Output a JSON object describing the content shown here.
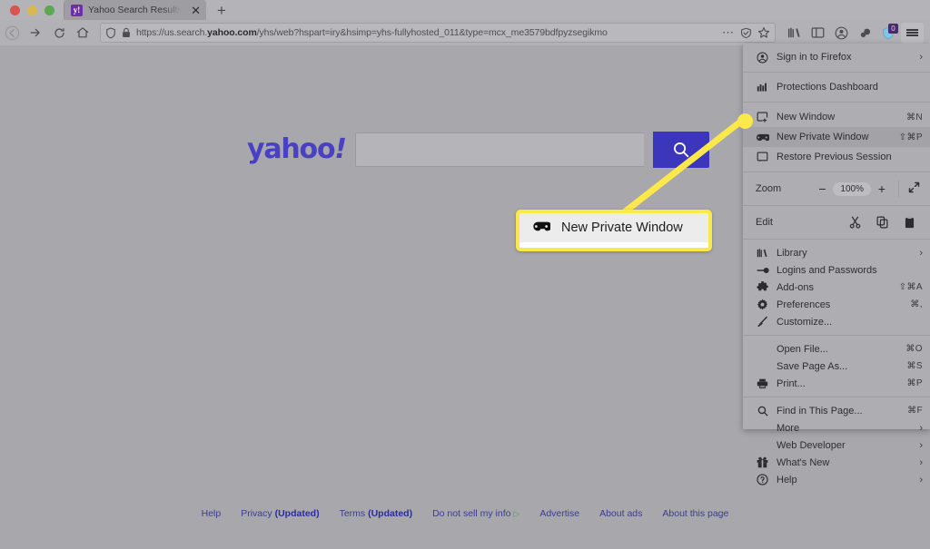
{
  "window": {
    "traffic_lights": [
      "close",
      "minimize",
      "maximize"
    ]
  },
  "tabbar": {
    "tab_title": "Yahoo Search Results - Web Se",
    "favicon_letter": "y!",
    "close_label": "✕",
    "newtab_label": "+"
  },
  "toolbar": {
    "back_label": "←",
    "forward_label": "→",
    "reload_label": "⟳",
    "home_label": "⌂",
    "url": "https://us.search.yahoo.com/yhs/web?hspart=iry&hsimp=yhs-fullyhosted_011&type=mcx_me3579bdfpyzsegikmo",
    "url_domain": "yahoo.com",
    "url_prefix": "https://us.search.",
    "url_suffix": "/yhs/web?hspart=iry&hsimp=yhs-fullyhosted_011&type=mcx_me3579bdfpyzsegikmo",
    "overflow_label": "⋯",
    "extension_badge": "0"
  },
  "content": {
    "brand": "yahoo",
    "brand_bang": "!",
    "search_value": "",
    "search_placeholder": ""
  },
  "footer": {
    "links": [
      {
        "label": "Help",
        "updated": ""
      },
      {
        "label": "Privacy",
        "updated": "(Updated)"
      },
      {
        "label": "Terms",
        "updated": "(Updated)"
      },
      {
        "label": "Do not sell my info",
        "updated": ""
      },
      {
        "label": "Advertise",
        "updated": ""
      },
      {
        "label": "About ads",
        "updated": ""
      },
      {
        "label": "About this page",
        "updated": ""
      }
    ]
  },
  "callout": {
    "label": "New Private Window",
    "highlight_color": "#fbe84a"
  },
  "menu": {
    "groups": [
      {
        "items": [
          {
            "label": "Sign in to Firefox",
            "key": "",
            "chevron": "›",
            "icon": "account-icon"
          },
          {
            "label": "Protections Dashboard",
            "key": "",
            "chevron": "",
            "icon": "shield-chart-icon"
          }
        ]
      },
      {
        "items": [
          {
            "label": "New Window",
            "key": "⌘N",
            "chevron": "",
            "icon": "new-window-icon"
          },
          {
            "label": "New Private Window",
            "key": "⇧⌘P",
            "chevron": "",
            "icon": "private-window-icon",
            "highlighted": true
          },
          {
            "label": "Restore Previous Session",
            "key": "",
            "chevron": "",
            "icon": "restore-session-icon"
          }
        ]
      }
    ],
    "zoom": {
      "label": "Zoom",
      "minus": "−",
      "value": "100%",
      "plus": "+",
      "fullscreen": "⤡"
    },
    "edit": {
      "label": "Edit",
      "cut": "cut-icon",
      "copy": "copy-icon",
      "paste": "paste-icon"
    },
    "group3": [
      {
        "label": "Library",
        "key": "",
        "chevron": "›",
        "icon": "library-icon"
      },
      {
        "label": "Logins and Passwords",
        "key": "",
        "chevron": "",
        "icon": "key-icon"
      },
      {
        "label": "Add-ons",
        "key": "⇧⌘A",
        "chevron": "",
        "icon": "puzzle-icon"
      },
      {
        "label": "Preferences",
        "key": "⌘,",
        "chevron": "",
        "icon": "gear-icon"
      },
      {
        "label": "Customize...",
        "key": "",
        "chevron": "",
        "icon": "brush-icon"
      }
    ],
    "group4": [
      {
        "label": "Open File...",
        "key": "⌘O",
        "chevron": "",
        "icon": ""
      },
      {
        "label": "Save Page As...",
        "key": "⌘S",
        "chevron": "",
        "icon": ""
      },
      {
        "label": "Print...",
        "key": "⌘P",
        "chevron": "",
        "icon": "printer-icon"
      }
    ],
    "group5": [
      {
        "label": "Find in This Page...",
        "key": "⌘F",
        "chevron": "",
        "icon": "search-icon"
      },
      {
        "label": "More",
        "key": "",
        "chevron": "›",
        "icon": ""
      },
      {
        "label": "Web Developer",
        "key": "",
        "chevron": "›",
        "icon": ""
      },
      {
        "label": "What's New",
        "key": "",
        "chevron": "›",
        "icon": "gift-icon"
      },
      {
        "label": "Help",
        "key": "",
        "chevron": "›",
        "icon": "help-icon"
      }
    ]
  }
}
